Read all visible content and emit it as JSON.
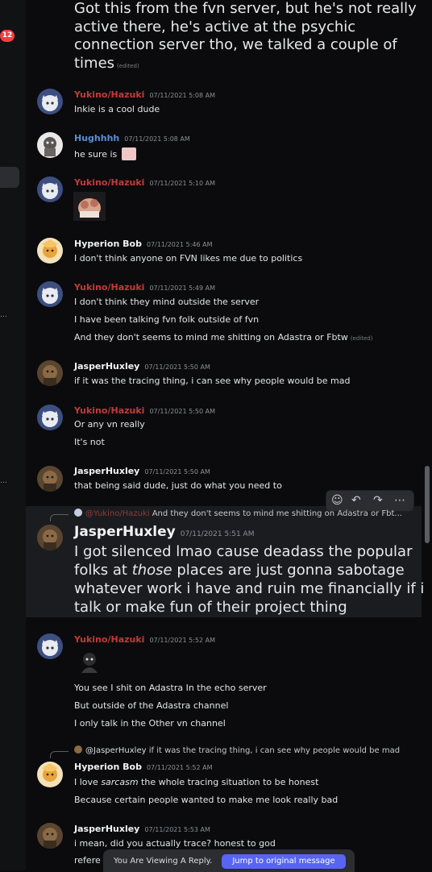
{
  "sidebar": {
    "badge": "12",
    "ellipsis_a": "…",
    "ellipsis_b": "…"
  },
  "top_message": {
    "lines": [
      "Got this from the fvn server, but he's not really",
      "active there,  he's active at the psychic",
      "connection server tho, we talked a couple of",
      "times"
    ],
    "edited": "(edited)"
  },
  "messages": [
    {
      "author": "Yukino/Hazuki",
      "time": "07/11/2021 5:08 AM",
      "lines": [
        "Inkie is a cool dude"
      ]
    },
    {
      "author": "Hughhhh",
      "time": "07/11/2021 5:08 AM",
      "lines": [
        "he sure is"
      ]
    },
    {
      "author": "Yukino/Hazuki",
      "time": "07/11/2021 5:10 AM",
      "lines": []
    },
    {
      "author": "Hyperion Bob",
      "time": "07/11/2021 5:46 AM",
      "lines": [
        "I don't think anyone on FVN likes me due to politics"
      ]
    },
    {
      "author": "Yukino/Hazuki",
      "time": "07/11/2021 5:49 AM",
      "lines": [
        "I don't think they mind outside the server",
        "I have been talking fvn folk outside of fvn",
        "And they don't seems to mind me shitting on Adastra or Fbtw"
      ],
      "edited": "(edited)"
    },
    {
      "author": "JasperHuxley",
      "time": "07/11/2021 5:50 AM",
      "lines": [
        "if it was the tracing thing, i can see why people would be mad"
      ]
    },
    {
      "author": "Yukino/Hazuki",
      "time": "07/11/2021 5:50 AM",
      "lines": [
        "Or any vn really",
        "It's not"
      ]
    },
    {
      "author": "JasperHuxley",
      "time": "07/11/2021 5:50 AM",
      "lines": [
        "that being said dude, just do what you need to"
      ]
    },
    {
      "author": "JasperHuxley",
      "time": "07/11/2021 5:51 AM",
      "reply": {
        "author": "@Yukino/Hazuki",
        "text": "And they don't seems to mind me shitting on Adastra or Fbt..."
      },
      "lines": [
        "I got silenced lmao cause deadass the popular",
        "folks  at ",
        "those",
        " places are just gonna sabotage",
        "whatever work i have and ruin me financially if i",
        "talk or make fun of their project thing"
      ]
    },
    {
      "author": "Yukino/Hazuki",
      "time": "07/11/2021 5:52 AM",
      "lines": [
        "You see I shit on Adastra In the echo server",
        "But outside of the Adastra channel",
        "I only talk in the Other vn channel"
      ]
    },
    {
      "author": "Hyperion Bob",
      "time": "07/11/2021 5:52 AM",
      "reply": {
        "author": "@JasperHuxley",
        "text": "if it was the tracing thing, i can see why people would be mad"
      },
      "lines": [
        "I love ",
        "sarcasm",
        " the whole tracing situation to be honest",
        "Because certain people wanted to make me look really bad"
      ]
    },
    {
      "author": "JasperHuxley",
      "time": "07/11/2021 5:53 AM",
      "lines": [
        "i mean, did you actually trace? honest to god",
        "refere"
      ]
    }
  ],
  "bottom_bar": {
    "text": "You Are Viewing A Reply.",
    "button": "Jump to original message"
  },
  "colors": {
    "red_name": "#c33a3a",
    "blue_name": "#5b8dd6",
    "accent": "#5865f2",
    "badge": "#f23f43"
  },
  "icons": [
    "add-reaction-icon",
    "reply-icon",
    "forward-icon",
    "more-options-icon"
  ]
}
